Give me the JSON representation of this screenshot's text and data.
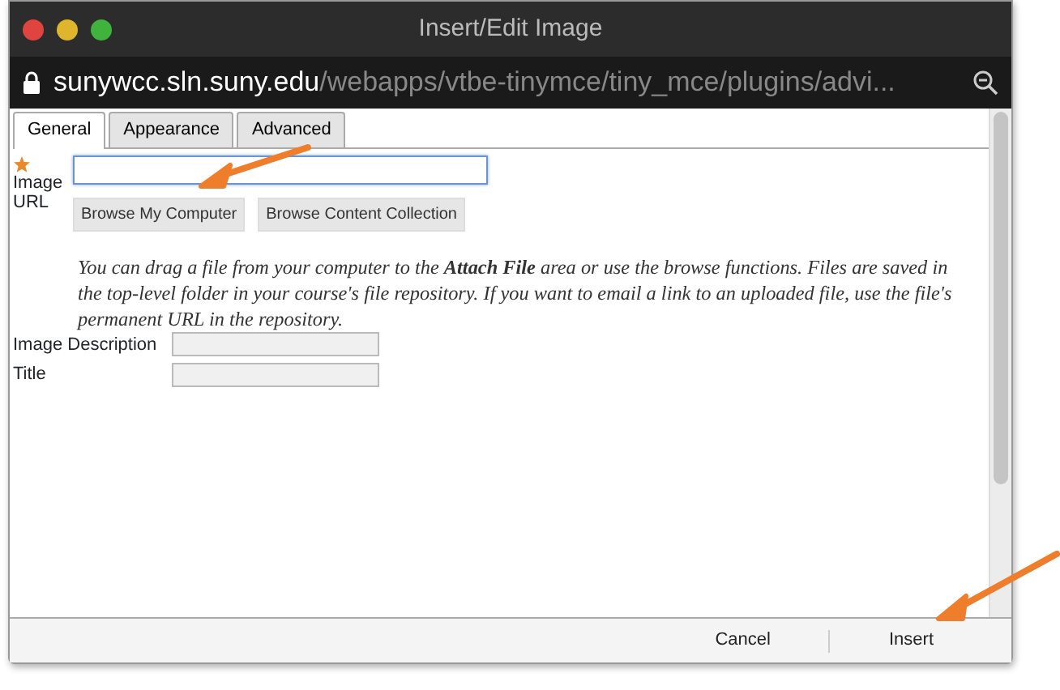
{
  "window": {
    "title": "Insert/Edit Image"
  },
  "address_bar": {
    "host": "sunywcc.sln.suny.edu",
    "path": "/webapps/vtbe-tinymce/tiny_mce/plugins/advi..."
  },
  "tabs": [
    {
      "label": "General",
      "selected": true
    },
    {
      "label": "Appearance",
      "selected": false
    },
    {
      "label": "Advanced",
      "selected": false
    }
  ],
  "image_url": {
    "label": "Image URL",
    "required": true,
    "focused": true
  },
  "browse_buttons": [
    "Browse My Computer",
    "Browse Content Collection"
  ],
  "help_text": "You can drag a file from your computer to the **Attach File** area or use the browse functions. Files are saved in the top-level folder in your course's file repository. If you want to email a link to an uploaded file, use the file's permanent URL in the repository.",
  "fields": [
    {
      "label": "Image Description"
    },
    {
      "label": "Title"
    }
  ],
  "footer_buttons": [
    "Cancel",
    "Insert"
  ]
}
